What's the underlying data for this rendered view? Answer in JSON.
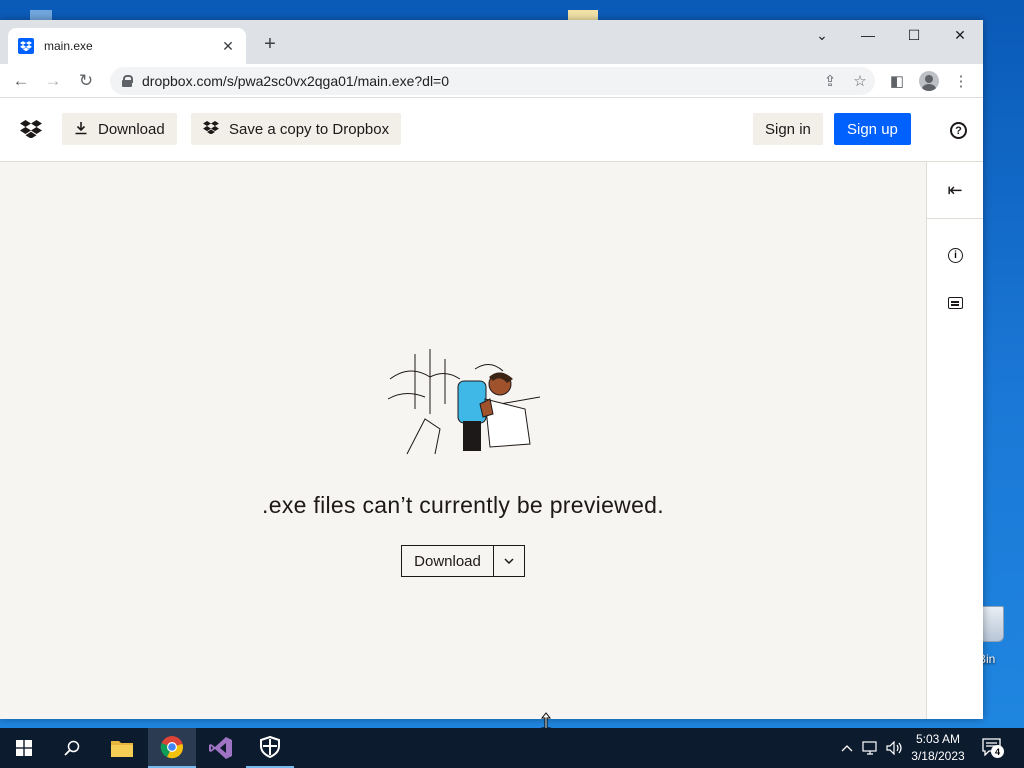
{
  "browser": {
    "tab_title": "main.exe",
    "tab_close": "✕",
    "new_tab": "+",
    "url": "dropbox.com/s/pwa2sc0vx2qga01/main.exe?dl=0",
    "window_controls": {
      "menu": "⌄",
      "minimize": "—",
      "maximize": "☐",
      "close": "✕"
    },
    "nav": {
      "back": "←",
      "forward": "→",
      "reload": "↻"
    },
    "toolbar_icons": {
      "share": "⇪",
      "bookmark": "☆",
      "sidepanel": "◧",
      "menu": "⋮"
    }
  },
  "dropbox": {
    "header": {
      "download_label": "Download",
      "save_copy_label": "Save a copy to Dropbox",
      "sign_in_label": "Sign in",
      "sign_up_label": "Sign up",
      "help_icon": "?"
    },
    "side_panel": {
      "collapse_icon": "⇤",
      "info_icon": "i"
    },
    "preview_message": ".exe files can’t currently be previewed.",
    "download_button_label": "Download",
    "download_caret": "⌵"
  },
  "desktop": {
    "recycle_label": "e Bin"
  },
  "taskbar": {
    "clock_time": "5:03 AM",
    "clock_date": "3/18/2023",
    "notification_count": "4"
  },
  "colors": {
    "dropbox_blue": "#0061fe",
    "page_bg": "#f7f5f2",
    "taskbar_bg": "#0d1b2e",
    "desktop_blue": "#1b78d6"
  }
}
